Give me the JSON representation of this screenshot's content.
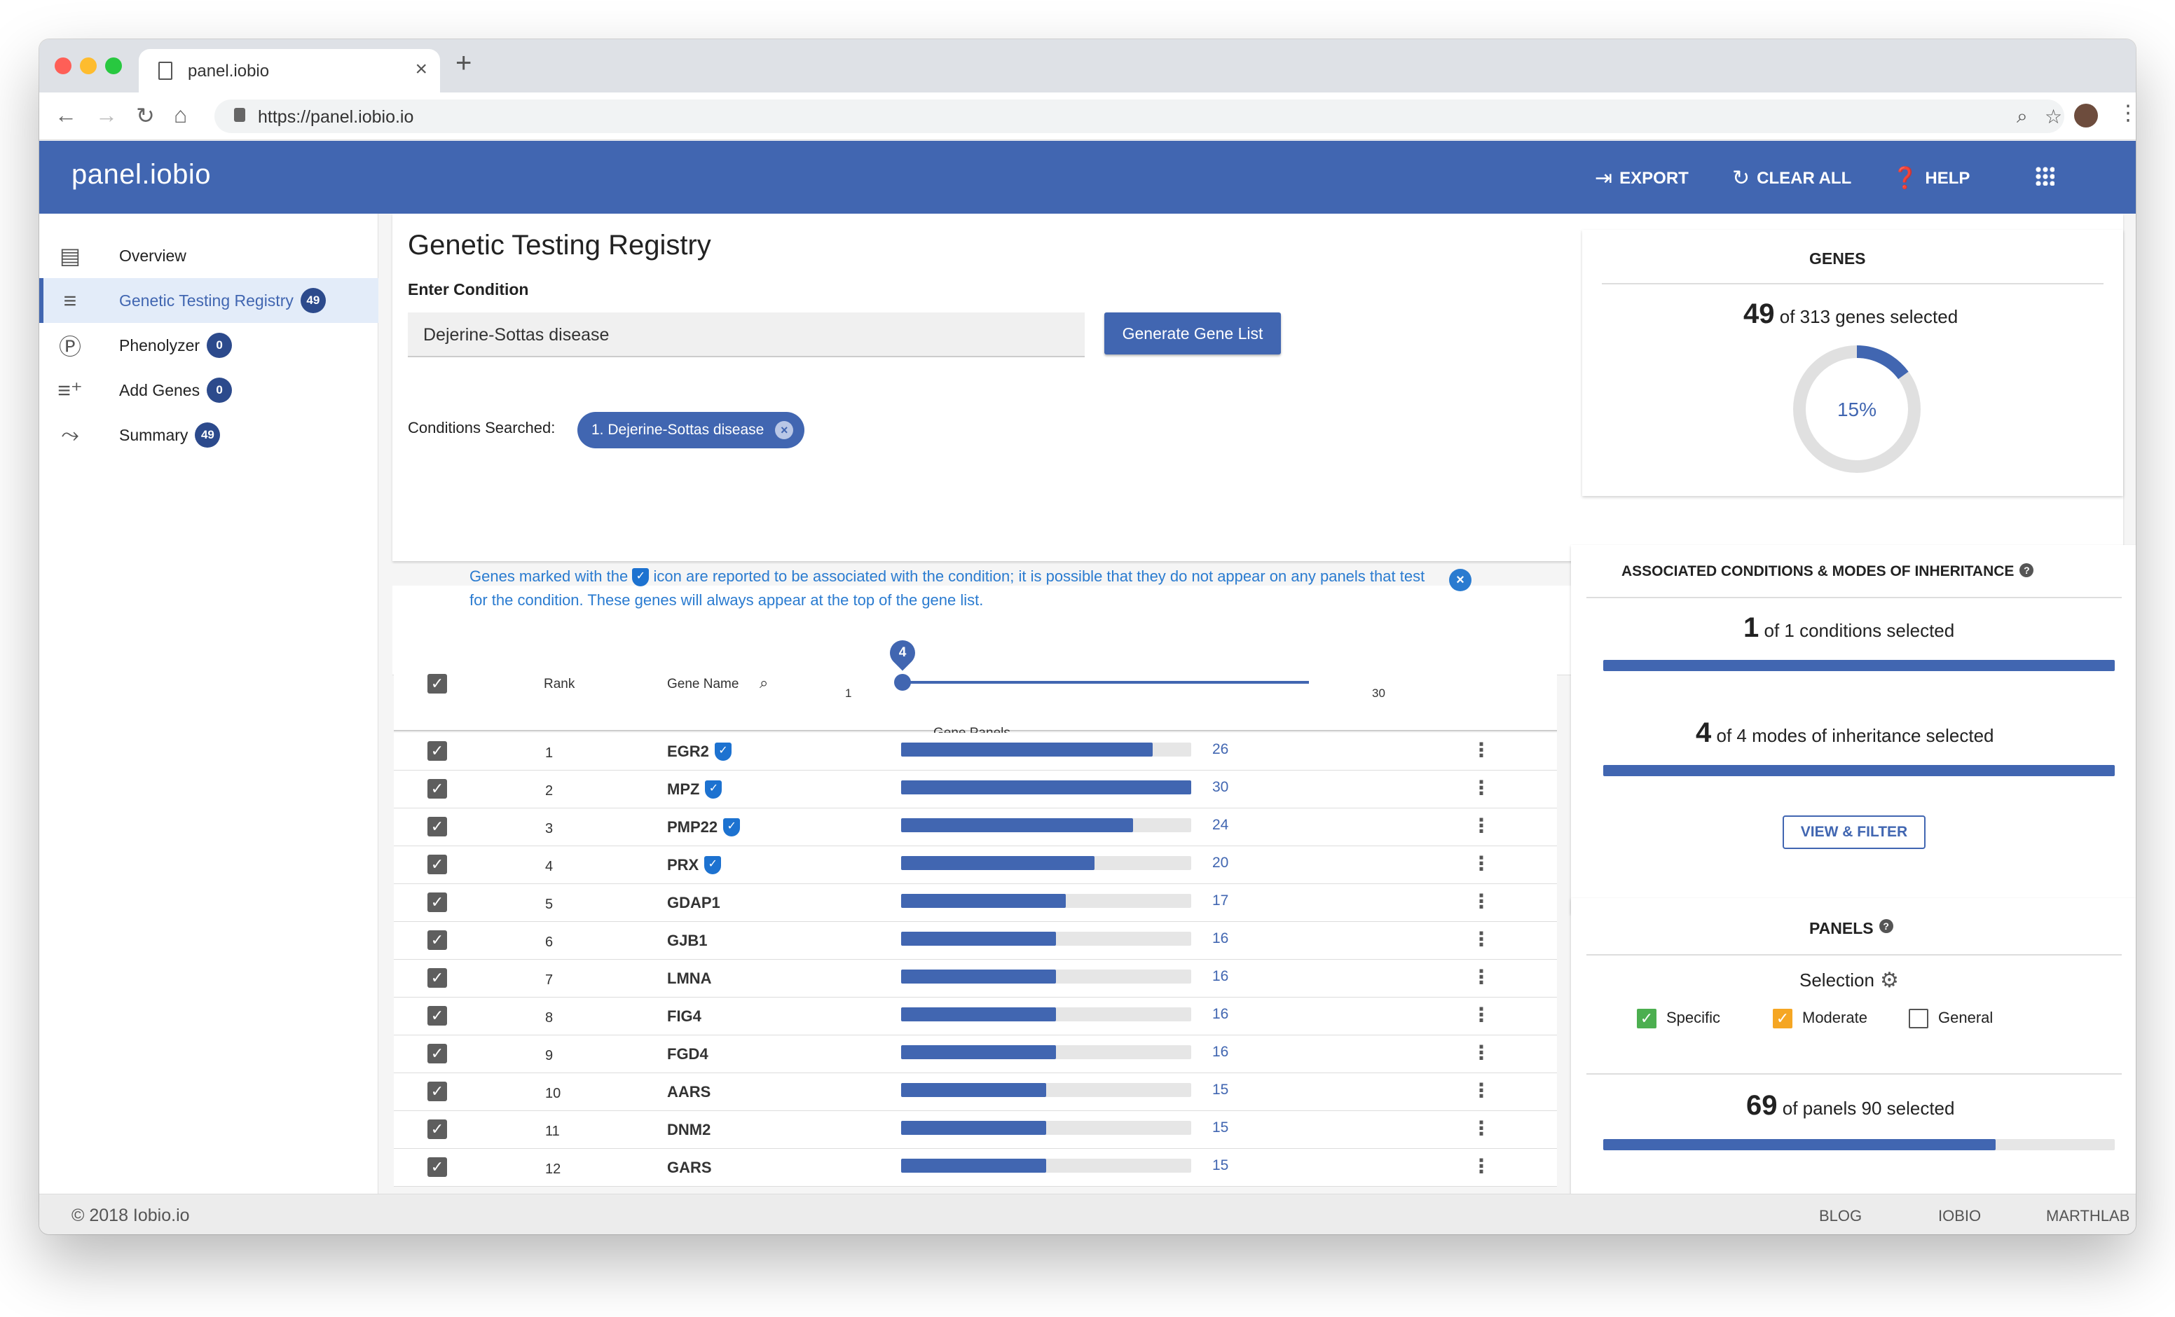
{
  "browser": {
    "tab_title": "panel.iobio",
    "tab_close": "×",
    "new_tab": "+",
    "url": "https://panel.iobio.io"
  },
  "appbar": {
    "brand": "panel.iobio",
    "export_label": "EXPORT",
    "clear_label": "CLEAR ALL",
    "help_label": "HELP"
  },
  "sidebar": {
    "items": [
      {
        "label": "Overview",
        "badge": null,
        "icon": "list-doc-icon"
      },
      {
        "label": "Genetic Testing Registry",
        "badge": "49",
        "icon": "sort-icon"
      },
      {
        "label": "Phenolyzer",
        "badge": "0",
        "icon": "p-icon"
      },
      {
        "label": "Add Genes",
        "badge": "0",
        "icon": "playlist-add-icon"
      },
      {
        "label": "Summary",
        "badge": "49",
        "icon": "merge-icon"
      }
    ]
  },
  "gtr": {
    "title": "Genetic Testing Registry",
    "enter_condition_label": "Enter Condition",
    "condition_value": "Dejerine-Sottas disease",
    "generate_btn": "Generate Gene List",
    "conditions_searched_label": "Conditions Searched:",
    "chip_label": "1. Dejerine-Sottas disease"
  },
  "info": {
    "text_before": "Genes marked with the",
    "text_after": "icon are reported to be associated with the condition; it is possible that they do not appear on any panels that test for the condition. These genes will always appear at the top of the gene list."
  },
  "table": {
    "col_rank": "Rank",
    "col_gene": "Gene Name",
    "col_panels": "Gene Panels",
    "slider_value": "4",
    "slider_min": "1",
    "slider_max": "30",
    "max_panels": 30,
    "rows": [
      {
        "rank": "1",
        "gene": "EGR2",
        "verified": true,
        "panels": 26
      },
      {
        "rank": "2",
        "gene": "MPZ",
        "verified": true,
        "panels": 30
      },
      {
        "rank": "3",
        "gene": "PMP22",
        "verified": true,
        "panels": 24
      },
      {
        "rank": "4",
        "gene": "PRX",
        "verified": true,
        "panels": 20
      },
      {
        "rank": "5",
        "gene": "GDAP1",
        "verified": false,
        "panels": 17
      },
      {
        "rank": "6",
        "gene": "GJB1",
        "verified": false,
        "panels": 16
      },
      {
        "rank": "7",
        "gene": "LMNA",
        "verified": false,
        "panels": 16
      },
      {
        "rank": "8",
        "gene": "FIG4",
        "verified": false,
        "panels": 16
      },
      {
        "rank": "9",
        "gene": "FGD4",
        "verified": false,
        "panels": 16
      },
      {
        "rank": "10",
        "gene": "AARS",
        "verified": false,
        "panels": 15
      },
      {
        "rank": "11",
        "gene": "DNM2",
        "verified": false,
        "panels": 15
      },
      {
        "rank": "12",
        "gene": "GARS",
        "verified": false,
        "panels": 15
      }
    ]
  },
  "genes_card": {
    "title": "GENES",
    "selected": "49",
    "suffix": "of 313 genes selected",
    "percent_label": "15%",
    "percent": 0.15
  },
  "conditions_card": {
    "title": "ASSOCIATED CONDITIONS & MODES OF INHERITANCE",
    "cond_selected": "1",
    "cond_suffix": "of 1 conditions selected",
    "cond_fraction": 1.0,
    "moi_selected": "4",
    "moi_suffix": "of 4 modes of inheritance selected",
    "moi_fraction": 1.0,
    "button": "VIEW & FILTER"
  },
  "panels_card": {
    "title": "PANELS",
    "selection_label": "Selection",
    "specific": "Specific",
    "moderate": "Moderate",
    "general": "General",
    "selected": "69",
    "suffix": "of panels 90 selected",
    "fraction": 0.767
  },
  "footer": {
    "copyright": "© 2018 Iobio.io",
    "links": [
      "BLOG",
      "IOBIO",
      "MARTHLAB"
    ]
  },
  "colors": {
    "primary": "#4166b1",
    "badge": "#2c4a8c",
    "info_text": "#2a7bd0",
    "specific_check": "#4caf50",
    "moderate_check": "#f5a623"
  }
}
